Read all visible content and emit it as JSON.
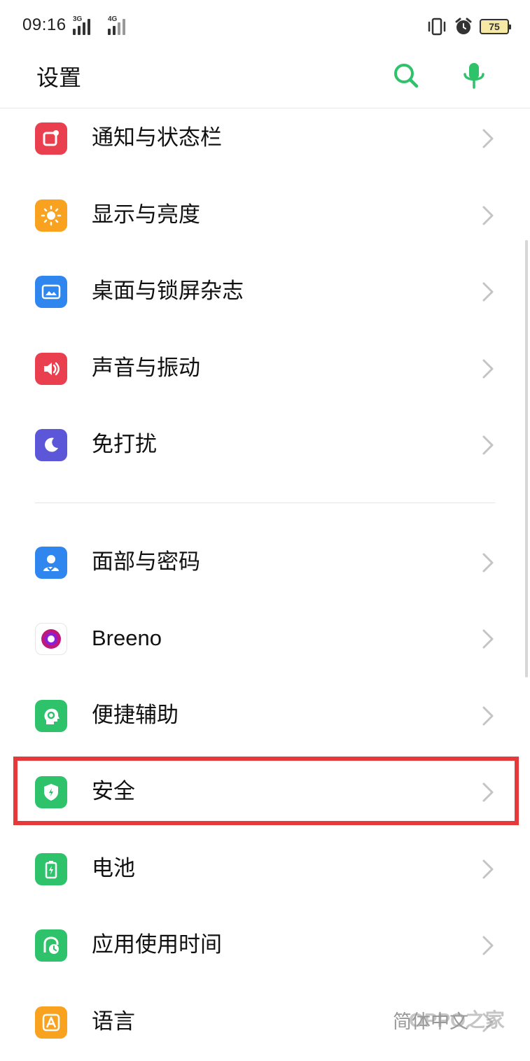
{
  "status_bar": {
    "time": "09:16",
    "network_1": "3G",
    "network_2": "4G",
    "battery_level": "75"
  },
  "header": {
    "title": "设置"
  },
  "items": [
    {
      "label": "通知与状态栏",
      "icon": "notification-icon",
      "color": "#ea3f4f"
    },
    {
      "label": "显示与亮度",
      "icon": "brightness-icon",
      "color": "#f8a21f"
    },
    {
      "label": "桌面与锁屏杂志",
      "icon": "wallpaper-icon",
      "color": "#2f86ee"
    },
    {
      "label": "声音与振动",
      "icon": "sound-icon",
      "color": "#ea3f4f"
    },
    {
      "label": "免打扰",
      "icon": "moon-icon",
      "color": "#5b57d8"
    },
    {
      "label": "面部与密码",
      "icon": "face-user-icon",
      "color": "#2f86ee"
    },
    {
      "label": "Breeno",
      "icon": "breeno-icon",
      "color": "#c0177b"
    },
    {
      "label": "便捷辅助",
      "icon": "assist-head-icon",
      "color": "#2ec26b"
    },
    {
      "label": "安全",
      "icon": "shield-icon",
      "color": "#2ec26b"
    },
    {
      "label": "电池",
      "icon": "battery-icon",
      "color": "#2ec26b"
    },
    {
      "label": "应用使用时间",
      "icon": "usage-clock-icon",
      "color": "#2ec26b"
    },
    {
      "label": "语言",
      "icon": "language-a-icon",
      "color": "#f8a21f",
      "value": "简体中文"
    }
  ],
  "highlighted_item": "安全",
  "watermark": "OPPO之家",
  "colors": {
    "accent_green": "#2ec26b",
    "highlight_red": "#e5393c"
  }
}
